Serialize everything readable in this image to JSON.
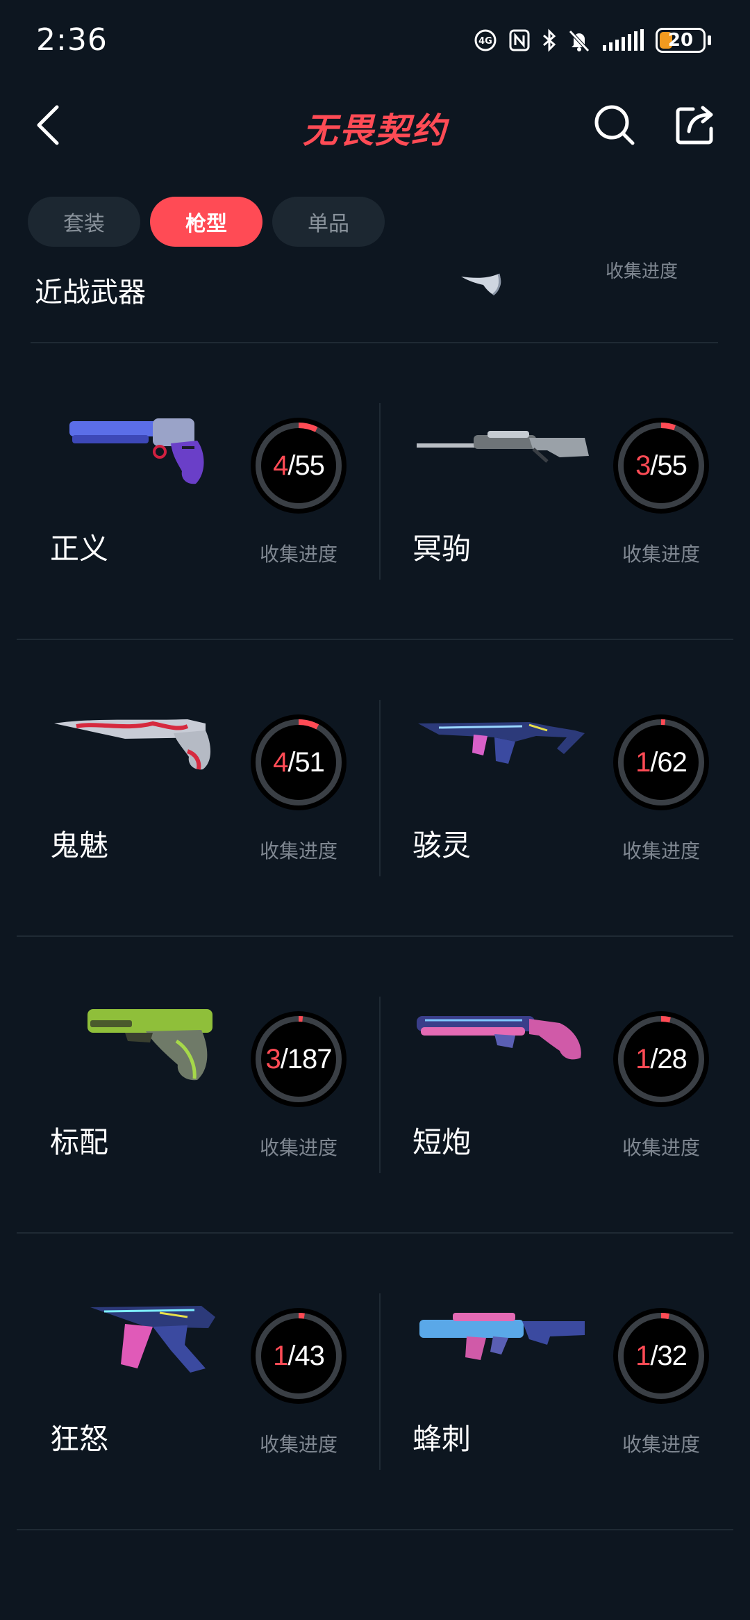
{
  "status_bar": {
    "time": "2:36",
    "battery": "20",
    "icons": [
      "hd-icon",
      "nfc-icon",
      "bluetooth-icon",
      "mute-icon",
      "signal-icon",
      "battery-icon"
    ]
  },
  "header": {
    "title": "无畏契约",
    "back_icon": "chevron-left-icon",
    "search_icon": "search-icon",
    "share_icon": "share-icon"
  },
  "tabs": [
    {
      "label": "套装",
      "active": false
    },
    {
      "label": "枪型",
      "active": true
    },
    {
      "label": "单品",
      "active": false
    }
  ],
  "partial_row": {
    "name": "近战武器",
    "progress_label": "收集进度"
  },
  "weapons": [
    {
      "name": "正义",
      "owned": "4",
      "total": "/55",
      "fraction": 0.073,
      "progress_label": "收集进度"
    },
    {
      "name": "冥驹",
      "owned": "3",
      "total": "/55",
      "fraction": 0.055,
      "progress_label": "收集进度"
    },
    {
      "name": "鬼魅",
      "owned": "4",
      "total": "/51",
      "fraction": 0.078,
      "progress_label": "收集进度"
    },
    {
      "name": "骇灵",
      "owned": "1",
      "total": "/62",
      "fraction": 0.016,
      "progress_label": "收集进度"
    },
    {
      "name": "标配",
      "owned": "3",
      "total": "/187",
      "fraction": 0.016,
      "progress_label": "收集进度"
    },
    {
      "name": "短炮",
      "owned": "1",
      "total": "/28",
      "fraction": 0.036,
      "progress_label": "收集进度"
    },
    {
      "name": "狂怒",
      "owned": "1",
      "total": "/43",
      "fraction": 0.023,
      "progress_label": "收集进度"
    },
    {
      "name": "蜂刺",
      "owned": "1",
      "total": "/32",
      "fraction": 0.031,
      "progress_label": "收集进度"
    }
  ],
  "colors": {
    "accent": "#ff4b55",
    "background": "#0d1620",
    "ring_track": "#3a3f45",
    "muted_text": "#7f8791"
  }
}
